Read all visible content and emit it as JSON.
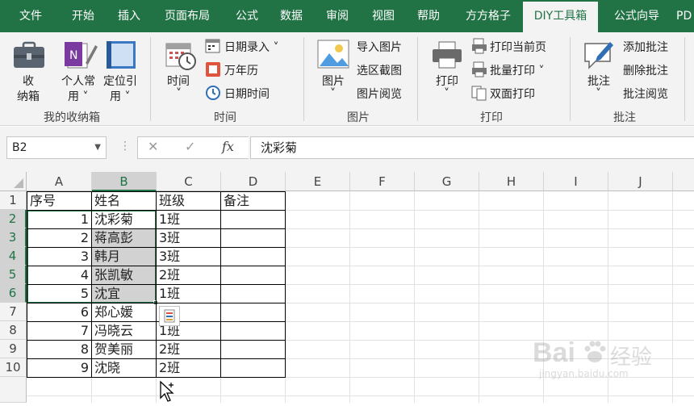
{
  "tabs": [
    {
      "label": "文件",
      "active": false
    },
    {
      "label": "开始",
      "active": false
    },
    {
      "label": "插入",
      "active": false
    },
    {
      "label": "页面布局",
      "active": false
    },
    {
      "label": "公式",
      "active": false
    },
    {
      "label": "数据",
      "active": false
    },
    {
      "label": "审阅",
      "active": false
    },
    {
      "label": "视图",
      "active": false
    },
    {
      "label": "帮助",
      "active": false
    },
    {
      "label": "方方格子",
      "active": false
    },
    {
      "label": "DIY工具箱",
      "active": true
    },
    {
      "label": "公式向导",
      "active": false
    },
    {
      "label": "PD",
      "active": false
    }
  ],
  "ribbon": {
    "box": {
      "label1": "收",
      "label2": "纳箱",
      "icon": "toolbox-icon"
    },
    "personal": {
      "label1": "个人常",
      "label2": "用",
      "icon": "notebook-icon"
    },
    "locate": {
      "label1": "定位引",
      "label2": "用",
      "icon": "book-icon"
    },
    "group1_label": "我的收纳箱",
    "time": {
      "label": "时间",
      "icon": "calendar-clock-icon"
    },
    "date_entry": "日期录入",
    "calendar": "万年历",
    "date_time": "日期时间",
    "group2_label": "时间",
    "picture": {
      "label": "图片",
      "icon": "picture-icon"
    },
    "import_picture": "导入图片",
    "region_capture": "选区截图",
    "picture_browse": "图片阅览",
    "group3_label": "图片",
    "print": {
      "label": "打印",
      "icon": "printer-icon"
    },
    "print_current": "打印当前页",
    "batch_print": "批量打印",
    "duplex_print": "双面打印",
    "group4_label": "打印",
    "comment": {
      "label": "批注",
      "icon": "comment-icon"
    },
    "add_comment": "添加批注",
    "delete_comment": "删除批注",
    "browse_comment": "批注阅览",
    "group5_label": "批注",
    "colors": {
      "accent": "#217346",
      "ribbon_bg": "#f3f3f3"
    }
  },
  "formula_bar": {
    "name_box": "B2",
    "cancel_icon": "✕",
    "enter_icon": "✓",
    "fx": "fx",
    "content": "沈彩菊"
  },
  "sheet": {
    "columns": [
      "A",
      "B",
      "C",
      "D",
      "E",
      "F",
      "G",
      "H",
      "I",
      "J"
    ],
    "selected_column": "B",
    "rows": [
      "1",
      "2",
      "3",
      "4",
      "5",
      "6",
      "7",
      "8",
      "9",
      "10"
    ],
    "selected_rows": [
      "2",
      "3",
      "4",
      "5",
      "6"
    ],
    "headers": [
      "序号",
      "姓名",
      "班级",
      "备注"
    ],
    "data": [
      {
        "no": "1",
        "name": "沈彩菊",
        "class": "1班",
        "note": ""
      },
      {
        "no": "2",
        "name": "蒋高彭",
        "class": "3班",
        "note": ""
      },
      {
        "no": "3",
        "name": "韩月",
        "class": "3班",
        "note": ""
      },
      {
        "no": "4",
        "name": "张凯敏",
        "class": "2班",
        "note": ""
      },
      {
        "no": "5",
        "name": "沈宜",
        "class": "1班",
        "note": ""
      },
      {
        "no": "6",
        "name": "郑心媛",
        "class": "",
        "note": ""
      },
      {
        "no": "7",
        "name": "冯晓云",
        "class": "1班",
        "note": ""
      },
      {
        "no": "8",
        "name": "贺美丽",
        "class": "2班",
        "note": ""
      },
      {
        "no": "9",
        "name": "沈晓",
        "class": "2班",
        "note": ""
      }
    ]
  },
  "watermark": {
    "brand": "Bai",
    "brand2": "经验",
    "url": "jingyan.baidu.com"
  }
}
